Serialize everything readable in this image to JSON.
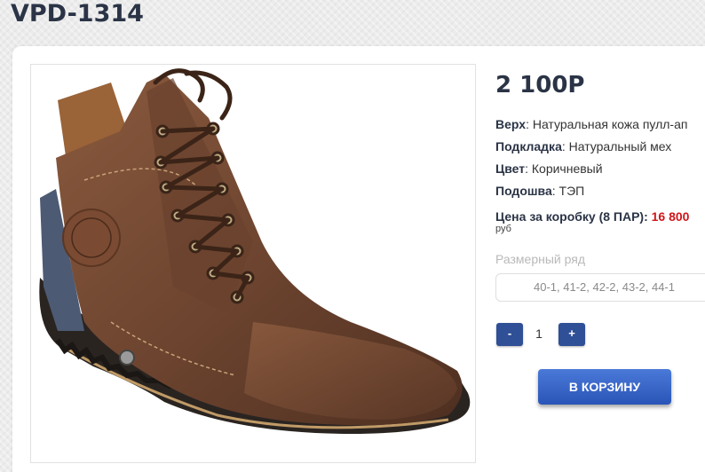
{
  "product": {
    "title": "VPD-1314",
    "price": "2 100Р",
    "image_alt": "brown-leather-boot"
  },
  "specs": [
    {
      "label": "Верх",
      "value": ": Натуральная кожа пулл-ап"
    },
    {
      "label": "Подкладка",
      "value": ": Натуральный мех"
    },
    {
      "label": "Цвет",
      "value": ": Коричневый"
    },
    {
      "label": "Подошва",
      "value": ": ТЭП"
    }
  ],
  "box_price": {
    "label": "Цена за коробку (8 ПАР):",
    "value": "16 800",
    "currency": "руб"
  },
  "sizes": {
    "label": "Размерный ряд",
    "value": "40-1, 41-2, 42-2, 43-2, 44-1"
  },
  "quantity": {
    "minus_label": "-",
    "value": "1",
    "plus_label": "+"
  },
  "cart": {
    "button_label": "В КОРЗИНУ"
  },
  "colors": {
    "title": "#2b3446",
    "accent_blue": "#2f4f96",
    "price_red": "#d0161a"
  }
}
